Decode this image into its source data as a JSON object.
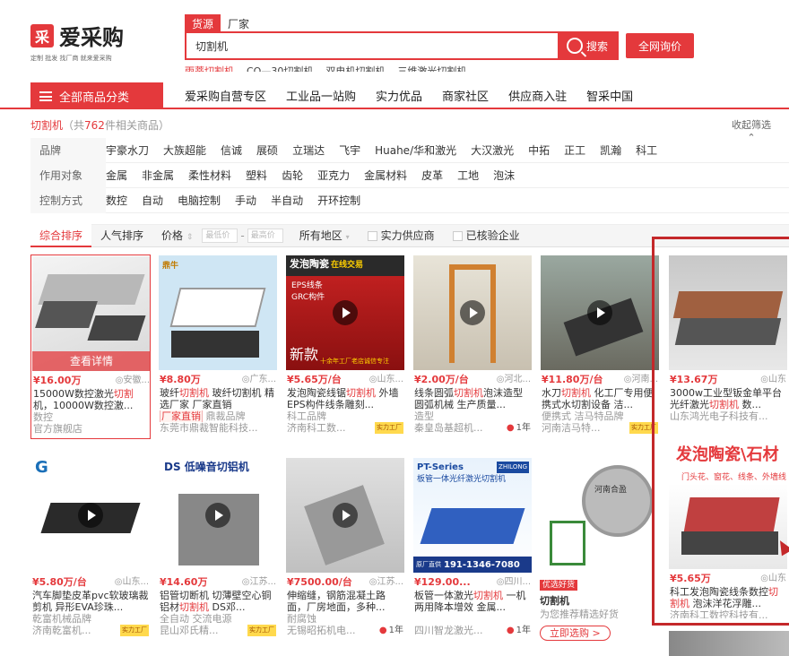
{
  "brand": {
    "logo_glyph": "采",
    "name": "爱采购",
    "slogan": "定制 批发 找厂商 就来爱采购"
  },
  "search": {
    "tabs": [
      "货源",
      "厂家"
    ],
    "value": "切割机",
    "button": "搜索",
    "inquiry": "全网询价",
    "hot": [
      "雨蒂切割机",
      "CQ—30切割机",
      "双电机切割机",
      "三维激光切割机"
    ]
  },
  "nav": {
    "category": "全部商品分类",
    "links": [
      "爱采购自营专区",
      "工业品一站购",
      "实力优品",
      "商家社区",
      "供应商入驻",
      "智采中国"
    ]
  },
  "crumb": {
    "keyword": "切割机",
    "pre": "（共",
    "count": "762",
    "post": "件相关商品）"
  },
  "collapse": "收起筛选",
  "filters": [
    {
      "label": "品牌",
      "options": [
        "宇豪水刀",
        "大族超能",
        "信诚",
        "展硕",
        "立瑞达",
        "飞宇",
        "Huahe/华和激光",
        "大汉激光",
        "中拓",
        "正工",
        "凯瀚",
        "科工"
      ]
    },
    {
      "label": "作用对象",
      "options": [
        "金属",
        "非金属",
        "柔性材料",
        "塑料",
        "齿轮",
        "亚克力",
        "金属材料",
        "皮革",
        "工地",
        "泡沫"
      ]
    },
    {
      "label": "控制方式",
      "options": [
        "数控",
        "自动",
        "电脑控制",
        "手动",
        "半自动",
        "开环控制"
      ]
    }
  ],
  "sort": {
    "items": [
      "综合排序",
      "人气排序",
      "价格"
    ],
    "min_ph": "最低价",
    "max_ph": "最高价",
    "region": "所有地区",
    "chk1": "实力供应商",
    "chk2": "已核验企业"
  },
  "products": [
    {
      "price": "¥16.00万",
      "loc": "◎安徽...",
      "title_pre": "15000W数控激光",
      "kw": "切割",
      "title_post": "机，10000W数控激...",
      "m1": "数控",
      "m2": "官方旗舰店",
      "side": ""
    },
    {
      "price": "¥8.80万",
      "loc": "◎广东...",
      "title_pre": "玻纤",
      "kw": "切割机",
      "title_post": " 玻纤切割机 精选厂家 厂家直销",
      "m1tag": "厂家直销",
      "m1": "鼎裁品牌",
      "m2": "东莞市鼎裁智能科技...",
      "side": ""
    },
    {
      "price": "¥5.65万/台",
      "loc": "◎山东...",
      "title_pre": "发泡陶瓷线锯",
      "kw": "切割机",
      "title_post": " 外墙EPS构件线条雕刻...",
      "m1": "科工品牌",
      "m2": "济南科工数...",
      "side": "实力工厂"
    },
    {
      "price": "¥2.00万/台",
      "loc": "◎河北...",
      "title_pre": "线条圆弧",
      "kw": "切割机",
      "title_post": "泡沫造型圆弧机械 生产质量...",
      "m1": "造型",
      "m2": "秦皇岛基超机...",
      "side": "1年"
    },
    {
      "price": "¥11.80万/台",
      "loc": "◎河南...",
      "title_pre": "水刀",
      "kw": "切割机",
      "title_post": " 化工厂专用便携式水切割设备 洁...",
      "m1": "便携式 洁马特品牌",
      "m2": "河南洁马特...",
      "side": "实力工厂"
    },
    {
      "price": "¥13.67万",
      "loc": "◎山东",
      "title_pre": "3000w工业型钣金单平台光纤激光",
      "kw": "切割机",
      "title_post": " 数...",
      "m1": "山东鸿光电子科技有...",
      "m2": "",
      "side": ""
    },
    {
      "price": "¥5.80万/台",
      "loc": "◎山东...",
      "title_pre": "汽车脚垫皮革pvc软玻璃裁剪机 异形EVA珍珠...",
      "kw": "",
      "title_post": "",
      "m1": "乾富机械品牌",
      "m2": "济南乾富机...",
      "side": "实力工厂"
    },
    {
      "price": "¥14.60万",
      "loc": "◎江苏...",
      "title_pre": "铝管切断机 切薄壁空心铜铝材",
      "kw": "切割机",
      "title_post": " DS邓...",
      "m1": "全自动 交流电源",
      "m2": "昆山邓氏精...",
      "side": "实力工厂"
    },
    {
      "price": "¥7500.00/台",
      "loc": "◎江苏...",
      "title_pre": "伸缩缝，钢筋混凝土路面，厂房地面，多种...",
      "kw": "",
      "title_post": "",
      "m1": "耐腐蚀",
      "m2": "无锡昭拓机电...",
      "side": "1年"
    },
    {
      "price": "¥129.00...",
      "loc": "◎四川...",
      "title_pre": "板管一体激光",
      "kw": "切割机",
      "title_post": " 一机两用降本增效 金属...",
      "m1": "",
      "m2": "四川智龙激光...",
      "side": "1年"
    },
    {
      "price": "",
      "loc": "",
      "title_pre": "",
      "kw": "",
      "title_post": "",
      "m1": "为您推荐精选好货",
      "m2": "",
      "side": ""
    },
    {
      "price": "¥5.65万",
      "loc": "◎山东",
      "title_pre": "科工发泡陶瓷线条数控",
      "kw": "切割机",
      "title_post": " 泡沫洋花浮雕...",
      "m1": "济南科工数控科技有...",
      "m2": "",
      "side": ""
    }
  ],
  "overlays": {
    "p1": "查看详情",
    "p3a": "发泡陶瓷",
    "p3b": "在线交易",
    "p3c": "EPS线条",
    "p3d": "GRC构件",
    "p3e": "新款",
    "p3f": "十余年工厂老店诚信专注",
    "p2": "鼎牛",
    "p7": "DS 低噪音切铝机",
    "p10a": "PT-Series",
    "p10b": "ZHILONG",
    "p10c": "板管一体光纤激光切割机",
    "p10d": "原厂直供",
    "p10e": "191-1346-7080",
    "p11a": "优选好货",
    "p11b": "切割机",
    "p11c": "立即选购 >",
    "p11d": "河南合盈",
    "p12a": "发泡陶瓷\\石材",
    "p12b": "门头花、窗花、线条、外墙线"
  }
}
